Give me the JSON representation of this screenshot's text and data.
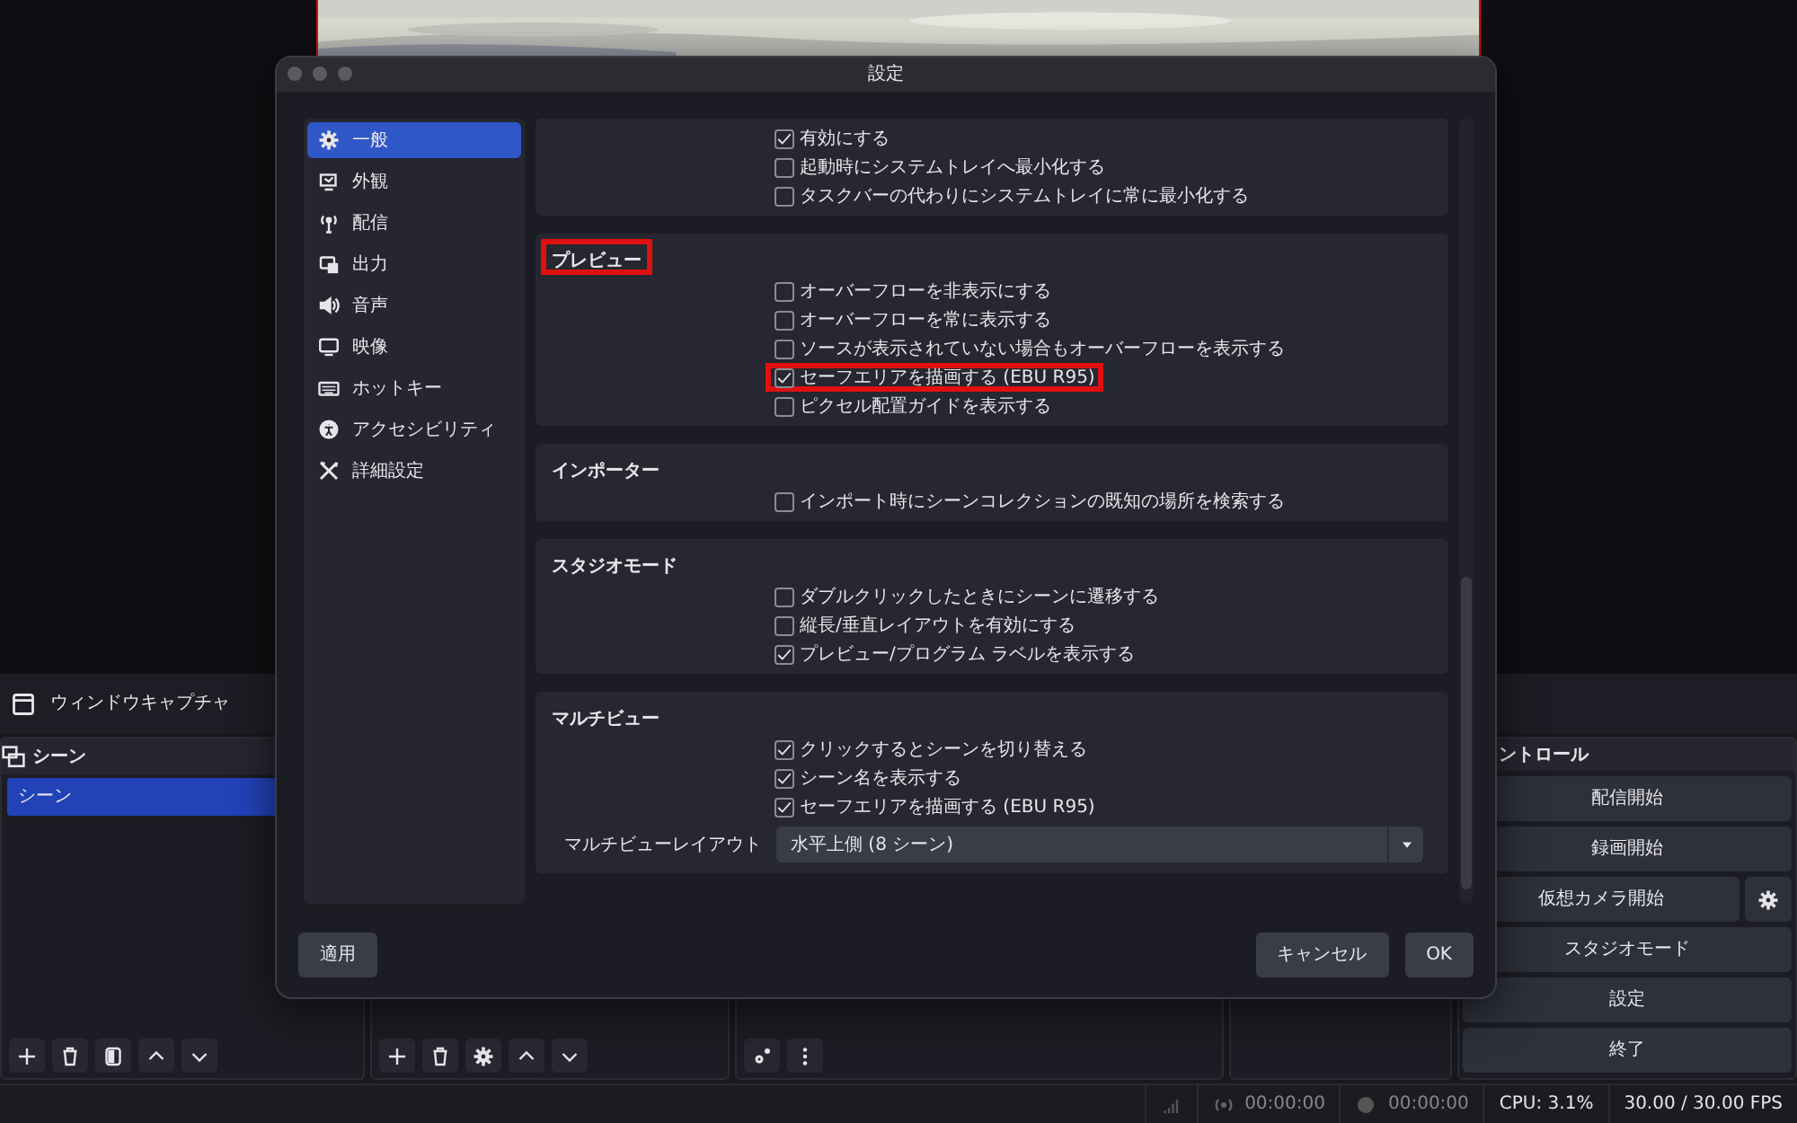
{
  "source_bar": {
    "source_name": "ウィンドウキャプチャ"
  },
  "scenes_dock": {
    "title": "シーン",
    "items": [
      {
        "label": "シーン",
        "selected": true
      }
    ]
  },
  "controls_dock": {
    "title": "ントロール",
    "buttons": [
      {
        "label": "配信開始",
        "has_settings": false
      },
      {
        "label": "録画開始",
        "has_settings": false
      },
      {
        "label": "仮想カメラ開始",
        "has_settings": true
      },
      {
        "label": "スタジオモード",
        "has_settings": false
      },
      {
        "label": "設定",
        "has_settings": false
      },
      {
        "label": "終了",
        "has_settings": false
      }
    ]
  },
  "status_bar": {
    "stream_time": "00:00:00",
    "record_time": "00:00:00",
    "cpu": "CPU: 3.1%",
    "fps": "30.00 / 30.00 FPS"
  },
  "dialog": {
    "title": "設定",
    "sidebar": [
      {
        "label": "一般",
        "selected": true
      },
      {
        "label": "外観",
        "selected": false
      },
      {
        "label": "配信",
        "selected": false
      },
      {
        "label": "出力",
        "selected": false
      },
      {
        "label": "音声",
        "selected": false
      },
      {
        "label": "映像",
        "selected": false
      },
      {
        "label": "ホットキー",
        "selected": false
      },
      {
        "label": "アクセシビリティ",
        "selected": false
      },
      {
        "label": "詳細設定",
        "selected": false
      }
    ],
    "sections": [
      {
        "items": [
          {
            "label": "有効にする",
            "checked": true,
            "highlighted": false
          },
          {
            "label": "起動時にシステムトレイへ最小化する",
            "checked": false,
            "highlighted": false
          },
          {
            "label": "タスクバーの代わりにシステムトレイに常に最小化する",
            "checked": false,
            "highlighted": false
          }
        ]
      },
      {
        "title": "プレビュー",
        "highlighted": true,
        "items": [
          {
            "label": "オーバーフローを非表示にする",
            "checked": false,
            "highlighted": false
          },
          {
            "label": "オーバーフローを常に表示する",
            "checked": false,
            "highlighted": false
          },
          {
            "label": "ソースが表示されていない場合もオーバーフローを表示する",
            "checked": false,
            "highlighted": false
          },
          {
            "label": "セーフエリアを描画する (EBU R95)",
            "checked": true,
            "highlighted": true
          },
          {
            "label": "ピクセル配置ガイドを表示する",
            "checked": false,
            "highlighted": false
          }
        ]
      },
      {
        "title": "インポーター",
        "highlighted": false,
        "items": [
          {
            "label": "インポート時にシーンコレクションの既知の場所を検索する",
            "checked": false,
            "highlighted": false
          }
        ]
      },
      {
        "title": "スタジオモード",
        "highlighted": false,
        "items": [
          {
            "label": "ダブルクリックしたときにシーンに遷移する",
            "checked": false,
            "highlighted": false
          },
          {
            "label": "縦長/垂直レイアウトを有効にする",
            "checked": false,
            "highlighted": false
          },
          {
            "label": "プレビュー/プログラム ラベルを表示する",
            "checked": true,
            "highlighted": false
          }
        ]
      },
      {
        "title": "マルチビュー",
        "highlighted": false,
        "items": [
          {
            "label": "クリックするとシーンを切り替える",
            "checked": true,
            "highlighted": false
          },
          {
            "label": "シーン名を表示する",
            "checked": true,
            "highlighted": false
          },
          {
            "label": "セーフエリアを描画する (EBU R95)",
            "checked": true,
            "highlighted": false
          }
        ],
        "select": {
          "label": "マルチビューレイアウト",
          "value": "水平上側 (8 シーン)"
        }
      }
    ],
    "apply_button": "適用",
    "cancel_button": "キャンセル",
    "ok_button": "OK"
  }
}
